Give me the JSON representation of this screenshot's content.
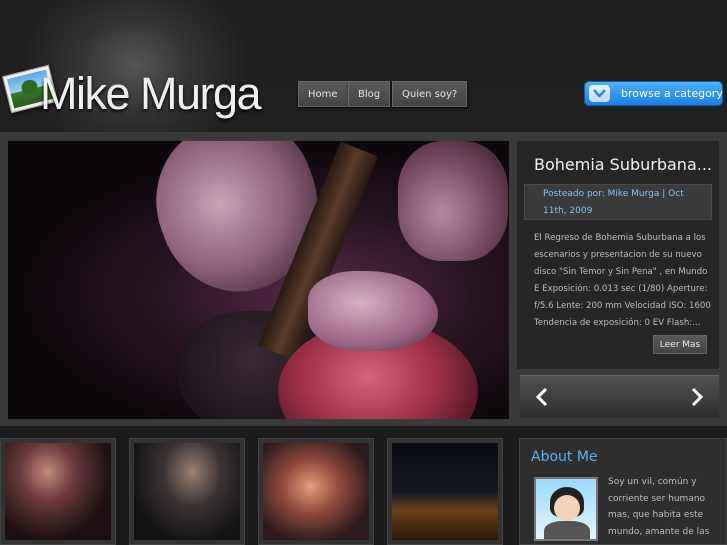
{
  "site": {
    "title": "Mike Murga"
  },
  "nav": {
    "items": [
      "Home",
      "Blog",
      "Quien soy?"
    ]
  },
  "browse": {
    "label": "browse a category"
  },
  "featured": {
    "title": "Bohemia Suburbana...",
    "meta": "Posteado por: Mike Murga | Oct 11th, 2009",
    "excerpt": "El Regreso de Bohemia Suburbana a los escenarios y presentacion de su nuevo disco \"Sin Temor y Sin Pena\" , en Mundo E Exposición: 0.013 sec (1/80) Aperture: f/5.6 Lente: 200 mm Velocidad ISO: 1600 Tendencia de exposición: 0 EV Flash:...",
    "read_more": "Leer Mas"
  },
  "about": {
    "title": "About Me",
    "text": "Soy un vil, común y corriente ser humano mas, que habita este mundo, amante de las"
  },
  "icons": {
    "browse": "chevron-down-icon",
    "prev": "chevron-left-icon",
    "next": "chevron-right-icon"
  },
  "colors": {
    "accent": "#5ab0f5",
    "browse_button": "#2a90f0"
  }
}
